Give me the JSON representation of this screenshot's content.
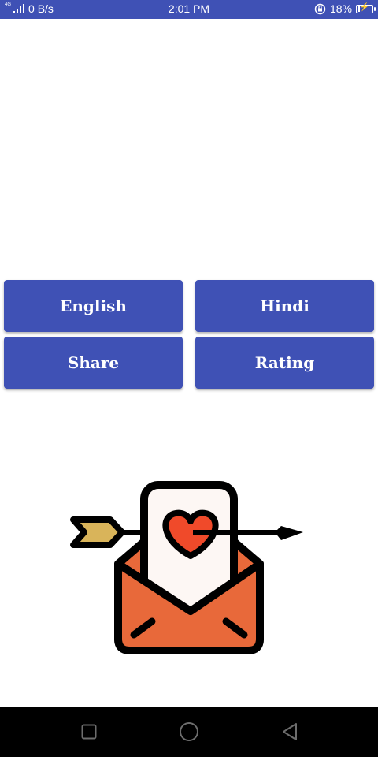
{
  "status_bar": {
    "network_tag": "4G",
    "data_speed": "0 B/s",
    "time": "2:01 PM",
    "battery_percent": "18%",
    "battery_level": 0.18,
    "icons": [
      "signal-icon",
      "rotation-lock-icon",
      "battery-charging-icon"
    ]
  },
  "buttons": {
    "english": "English",
    "hindi": "Hindi",
    "share": "Share",
    "rating": "Rating"
  },
  "illustration": {
    "icon": "love-letter-arrow-icon",
    "colors": {
      "envelope": "#e8693a",
      "letter": "#fdf7f4",
      "heart": "#f04a2a",
      "arrow_tail": "#d9b45a",
      "outline": "#000000"
    }
  },
  "nav_bar": {
    "icons": [
      "recents-icon",
      "home-icon",
      "back-icon"
    ]
  },
  "colors": {
    "primary": "#3f51b5",
    "background": "#ffffff",
    "nav_background": "#000000"
  }
}
